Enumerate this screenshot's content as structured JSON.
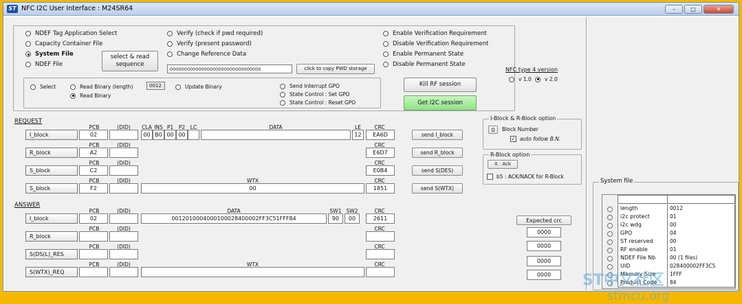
{
  "window": {
    "title": "NFC I2C User Interface  :  M24SR64",
    "logo": "ST",
    "minimize": "–",
    "maximize": "□",
    "close": "✕"
  },
  "file_select": {
    "options": [
      "NDEF Tag Application Select",
      "Capacity Container File",
      "System File",
      "NDEF File"
    ],
    "selected": 2,
    "select_read_button": "select & read\nsequence"
  },
  "verify": {
    "options": [
      "Verify (check if pwd required)",
      "Verify (present password)",
      "Change Reference Data"
    ],
    "password_value": "00000000000000000000000000000000",
    "copy_pwd_button": "click to copy PWD storage"
  },
  "requirements": {
    "options": [
      "Enable Verification Requirement",
      "Disable Verification Requirement",
      "Enable Permanent State",
      "Disable Permanent State"
    ]
  },
  "nfc_version": {
    "title": "NFC type 4 version",
    "options": [
      "v 1.0",
      "v 2.0"
    ],
    "selected": 1
  },
  "commands": {
    "select": "Select",
    "read_binary_length": "Read Binary (length)",
    "read_binary": "Read Binary",
    "length_value": "0012",
    "update_binary": "Update Binary",
    "send_interrupt": "Send Interrupt GPO",
    "state_set": "State Control : Set GPO",
    "state_reset": "State Control : Reset GPO"
  },
  "session": {
    "kill_rf": "Kill RF session",
    "get_i2c": "Get I2C session"
  },
  "request": {
    "title": "REQUEST",
    "headers": {
      "pcb": "PCB",
      "did": "(DID)",
      "cla": "CLA",
      "ins": "INS",
      "p1": "P1",
      "p2": "P2",
      "lc": "LC",
      "data": "DATA",
      "le": "LE",
      "crc": "CRC",
      "wtx": "WTX"
    },
    "i_block": {
      "label": "I_block",
      "pcb": "02",
      "cla": "00",
      "ins": "B0",
      "p1": "00",
      "p2": "00",
      "le": "12",
      "crc": "EA6D",
      "send": "send I_block"
    },
    "r_block": {
      "label": "R_block",
      "pcb": "A2",
      "crc": "E6D7",
      "send": "send R_block"
    },
    "s_block": {
      "label": "S_block",
      "pcb": "C2",
      "crc": "E0B4",
      "send": "send S(DES)"
    },
    "s_wtx": {
      "label": "S_block",
      "pcb": "F2",
      "wtx": "00",
      "crc": "1851",
      "send": "send S(WTX)"
    }
  },
  "answer": {
    "title": "ANSWER",
    "headers": {
      "pcb": "PCB",
      "did": "(DID)",
      "data": "DATA",
      "sw1": "SW1",
      "sw2": "SW2",
      "crc": "CRC",
      "wtx": "WTX"
    },
    "i_block": {
      "label": "I_block",
      "pcb": "02",
      "data": "0012010004000100028400002FF3C51FFF84",
      "sw1": "90",
      "sw2": "00",
      "crc": "2611"
    },
    "r_block": {
      "label": "R_block"
    },
    "s_des": {
      "label": "S(DS(L)_RES"
    },
    "s_wtx": {
      "label": "S(WTX)_REQ"
    }
  },
  "expected_crc": {
    "label": "Expected crc",
    "values": [
      "0000",
      "0000",
      "0000",
      "0000"
    ]
  },
  "iblock_option": {
    "title": "I-Block & R-Block option",
    "block_number_value": "0",
    "block_number_label": "Block Number",
    "auto_follow_label": "auto follow B.N.",
    "auto_follow_checked": "✓"
  },
  "rblock_option": {
    "title": "R-Block option",
    "ack_button": "0 : Ack",
    "b5_label": "b5 : ACK/NACK for R-Block"
  },
  "system_file": {
    "title": "System file",
    "rows": [
      {
        "name": "length",
        "value": "0012"
      },
      {
        "name": "i2c protect",
        "value": "01"
      },
      {
        "name": "i2c wdg",
        "value": "00"
      },
      {
        "name": "GPO",
        "value": "04"
      },
      {
        "name": "ST reserved",
        "value": "00"
      },
      {
        "name": "RF enable",
        "value": "01"
      },
      {
        "name": "NDEF File Nb",
        "value": "00  (1 files)"
      },
      {
        "name": "UID",
        "value": "028400002FF3C5"
      },
      {
        "name": "Memory Size",
        "value": "1FFF"
      },
      {
        "name": "Product Code",
        "value": "84"
      }
    ]
  },
  "watermark": {
    "line1": "ST中文社区",
    "line2": "stmcu.org"
  }
}
